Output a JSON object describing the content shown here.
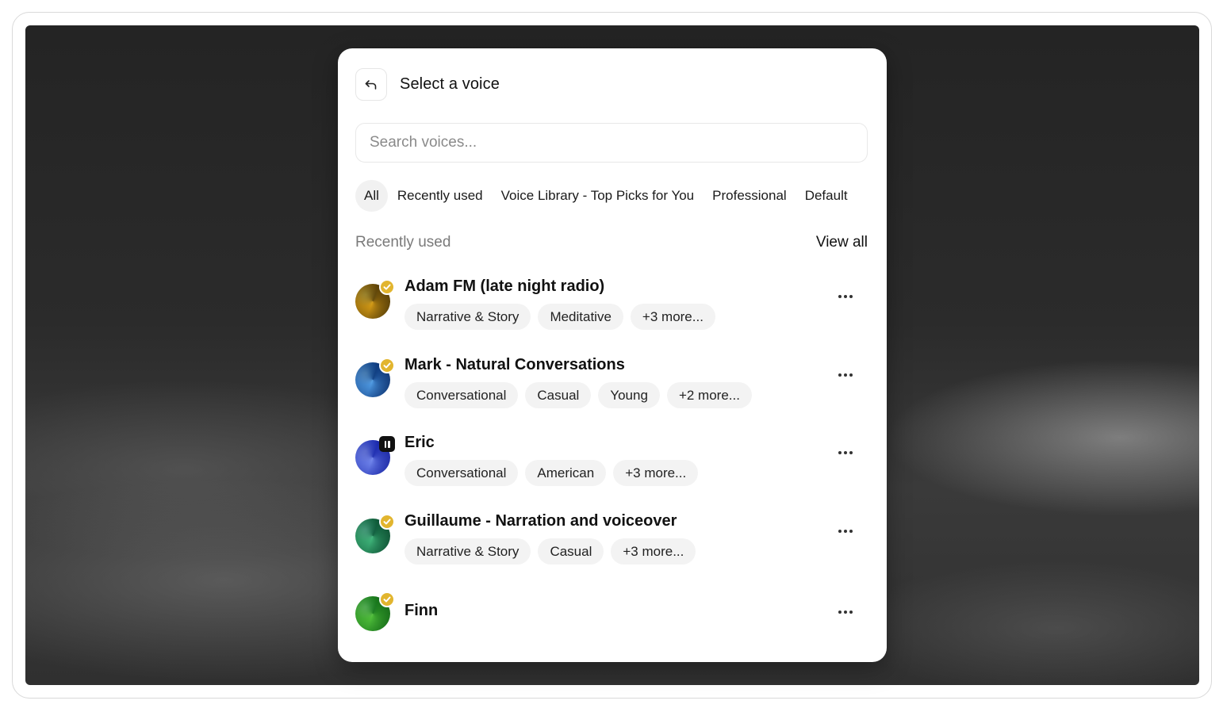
{
  "modal": {
    "title": "Select a voice",
    "search_placeholder": "Search voices...",
    "tabs": [
      "All",
      "Recently used",
      "Voice Library - Top Picks for You",
      "Professional",
      "Default"
    ],
    "active_tab": "All",
    "section_label": "Recently used",
    "view_all_label": "View all"
  },
  "voices": [
    {
      "name": "Adam FM (late night radio)",
      "tags": [
        "Narrative & Story",
        "Meditative",
        "+3 more..."
      ],
      "badge": "verified-icon",
      "avatar_colors": [
        "#e8c64a",
        "#6b5a1c"
      ]
    },
    {
      "name": "Mark - Natural Conversations",
      "tags": [
        "Conversational",
        "Casual",
        "Young",
        "+2 more..."
      ],
      "badge": "verified-icon",
      "avatar_colors": [
        "#8ec6f0",
        "#1c4f8a"
      ]
    },
    {
      "name": "Eric",
      "tags": [
        "Conversational",
        "American",
        "+3 more..."
      ],
      "badge": "pause-icon",
      "avatar_colors": [
        "#a9b8f5",
        "#2e3fb8"
      ]
    },
    {
      "name": "Guillaume - Narration and voiceover",
      "tags": [
        "Narrative & Story",
        "Casual",
        "+3 more..."
      ],
      "badge": "verified-icon",
      "avatar_colors": [
        "#7fd6b0",
        "#1f6e55"
      ]
    },
    {
      "name": "Finn",
      "tags": [],
      "badge": "verified-icon",
      "avatar_colors": [
        "#8fdc7a",
        "#2b8a3a"
      ]
    }
  ]
}
